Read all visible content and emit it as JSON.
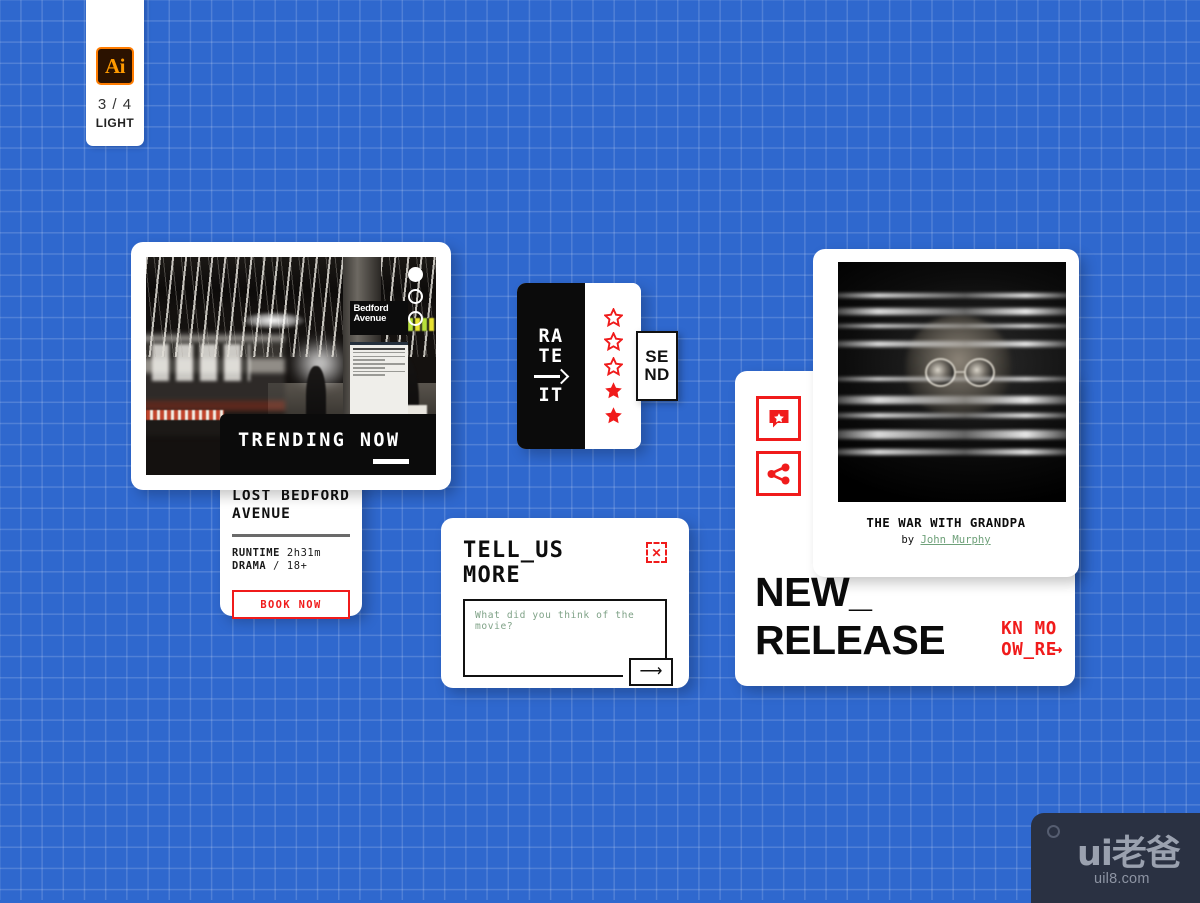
{
  "background": {
    "color": "#2F68CE",
    "grid_line_color": "rgba(255,255,255,0.16)",
    "grid_size_px": 21
  },
  "ai_badge": {
    "icon_label": "Ai",
    "icon_name": "adobe-illustrator-icon",
    "page_indicator": "3 / 4",
    "theme_label": "LIGHT",
    "accent_color": "#FF7C00"
  },
  "poster_card": {
    "photo_alt_signs": {
      "station_sign": "Bedford\nAvenue"
    },
    "badge_label": "TRENDING NOW"
  },
  "movie_info_card": {
    "title_line1": "LOST BEDFORD",
    "title_line2": "AVENUE",
    "runtime_label": "RUNTIME",
    "runtime_value": "2h31m",
    "genre_label": "DRAMA",
    "genre_separator": "/",
    "rating_value": "18+",
    "cta_label": "BOOK NOW",
    "cta_color": "#F01B1B"
  },
  "rate_widget": {
    "line1": "RA",
    "line2": "TE",
    "line3": "IT",
    "arrow_icon": "arrow-right-icon",
    "stars_total": 5,
    "stars_filled": 2,
    "star_color": "#F01B1B",
    "send_line1": "SE",
    "send_line2": "ND"
  },
  "feedback_card": {
    "title_line1": "TELL_US",
    "title_line2": "MORE",
    "close_label": "✕",
    "textarea_value": "",
    "textarea_placeholder": "What did you think of the movie?",
    "placeholder_color": "#7FA287",
    "submit_icon": "arrow-right-icon",
    "submit_glyph": "⟶"
  },
  "release_card": {
    "movie_title": "THE WAR WITH GRANDPA",
    "by_prefix": "by",
    "author_name": "John Murphy",
    "author_link_color": "#6FA17A",
    "heading_line1": "NEW_",
    "heading_line2": "RELEASE",
    "know_more_line1": "KN MO",
    "know_more_line2": "OW_RE",
    "know_more_arrow": "→",
    "know_more_color": "#F01B1B",
    "icons": [
      {
        "name": "review-bubble-star-icon"
      },
      {
        "name": "share-icon"
      }
    ]
  },
  "watermark": {
    "logo_text": "ui老爸",
    "url_text": "uil8.com",
    "background": "#2A3142"
  }
}
